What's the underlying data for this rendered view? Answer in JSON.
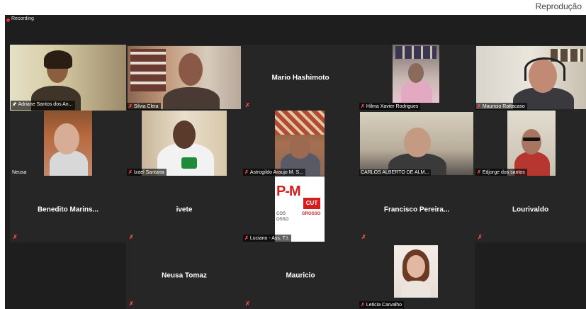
{
  "credit": "Reprodução",
  "recording_label": "Recording",
  "participants": [
    {
      "name": "Adriane Santos dos An...",
      "pinned": true
    },
    {
      "name": "Silvia Cleia"
    },
    {
      "name": "Mario Hashimoto"
    },
    {
      "name": "Hilma Xavier Rodrigues"
    },
    {
      "name": "Mauricio Rattacaso"
    },
    {
      "name": "Neusa"
    },
    {
      "name": "Izael Santana"
    },
    {
      "name": "Astrogildo Araujo M. S..."
    },
    {
      "name": "CARLOS ALBERTO DE ALM..."
    },
    {
      "name": "Edjorge dos santos"
    },
    {
      "name": "Benedito Marins..."
    },
    {
      "name": "ivete"
    },
    {
      "name": "Luciano - Ass. T.I."
    },
    {
      "name": "Francisco Pereira..."
    },
    {
      "name": "Lourivaldo"
    },
    {
      "name": "Neusa Tomaz"
    },
    {
      "name": "Mauricio"
    },
    {
      "name": "Leticia Carvalho"
    }
  ],
  "logo_text": {
    "top": "P-M",
    "badge": "CUT",
    "left": "COS",
    "bottom": "OSSO",
    "right": "GROSSO"
  },
  "colors": {
    "background": "#1e1e1e",
    "tile": "#262626",
    "active_border": "#c8cf3c",
    "mic_muted": "#ff4a4a"
  }
}
